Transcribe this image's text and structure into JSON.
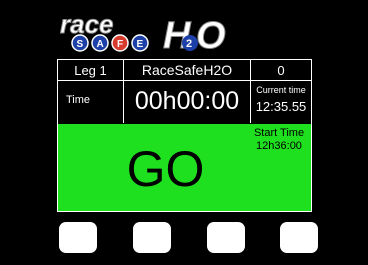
{
  "logo": {
    "line1": "race",
    "safe_letters": [
      "S",
      "A",
      "F",
      "E"
    ],
    "brand": "H2O"
  },
  "header": {
    "leg": "Leg 1",
    "title": "RaceSafeH2O",
    "counter": "0"
  },
  "timer": {
    "label": "Time",
    "value": "00h00:00",
    "current_time_label": "Current time",
    "current_time": "12:35.55"
  },
  "status": {
    "text": "GO",
    "start_time_label": "Start Time",
    "start_time": "12h36:00"
  },
  "colors": {
    "status_bg": "#1fe01f",
    "logo_blue": "#1c3fa8",
    "logo_red": "#d83a2e"
  },
  "buttons": [
    {
      "label": ""
    },
    {
      "label": ""
    },
    {
      "label": ""
    },
    {
      "label": ""
    }
  ]
}
